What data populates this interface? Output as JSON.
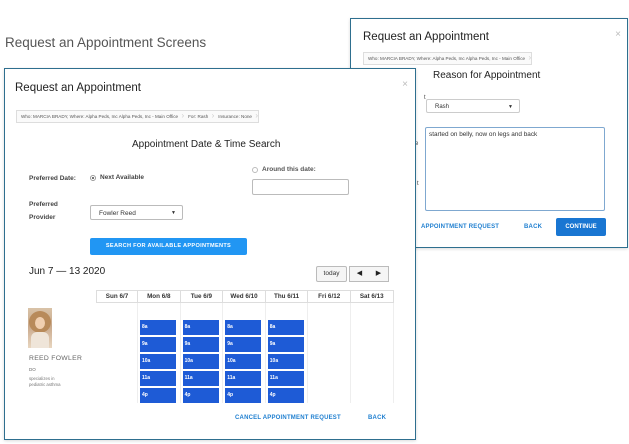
{
  "page": {
    "heading": "Request an Appointment Screens"
  },
  "reason_modal": {
    "title": "Request an Appointment",
    "close": "×",
    "breadcrumbs": [
      "Who: MARCIA BRADY, Where: Alpha Peds, Inc Alpha Peds, Inc - Main Office"
    ],
    "section_title": "Reason for Appointment",
    "reason_select": "Rash",
    "reason_text": "started on belly, now on legs and back",
    "cut_letters": [
      "t",
      "e",
      "t"
    ],
    "cancel_label": "APPOINTMENT REQUEST",
    "back_label": "BACK",
    "continue_label": "CONTINUE"
  },
  "date_modal": {
    "title": "Request an Appointment",
    "close": "×",
    "breadcrumbs": [
      "Who: MARCIA BRADY, Where: Alpha Peds, Inc Alpha Peds, Inc - Main Office",
      "For: Rash",
      "Insurance: None"
    ],
    "section_title": "Appointment Date & Time Search",
    "preferred_date_label": "Preferred Date:",
    "next_available_label": "Next Available",
    "around_date_label": "Around this date:",
    "preferred_provider_label_1": "Preferred",
    "preferred_provider_label_2": "Provider",
    "provider_select": "Fowler Reed",
    "search_button": "SEARCH FOR AVAILABLE APPOINTMENTS",
    "week_range": "Jun 7 — 13 2020",
    "today_button": "today",
    "prev_button": "◀",
    "next_button": "▶",
    "days": [
      {
        "label": "Sun 6/7",
        "slots": []
      },
      {
        "label": "Mon 6/8",
        "slots": [
          "8a",
          "9a",
          "10a",
          "11a",
          "4p"
        ]
      },
      {
        "label": "Tue 6/9",
        "slots": [
          "8a",
          "9a",
          "10a",
          "11a",
          "4p"
        ]
      },
      {
        "label": "Wed 6/10",
        "slots": [
          "8a",
          "9a",
          "10a",
          "11a",
          "4p"
        ]
      },
      {
        "label": "Thu 6/11",
        "slots": [
          "8a",
          "9a",
          "10a",
          "11a",
          "4p"
        ]
      },
      {
        "label": "Fri 6/12",
        "slots": []
      },
      {
        "label": "Sat 6/13",
        "slots": []
      }
    ],
    "provider_name": "REED FOWLER",
    "provider_credential": "DO",
    "provider_specialty": "specializes in pediatric asthma",
    "cancel_label": "CANCEL APPOINTMENT REQUEST",
    "back_label": "BACK"
  },
  "colors": {
    "primary": "#1976d2",
    "slot": "#1e5bd6",
    "border": "#2e6f8f"
  }
}
